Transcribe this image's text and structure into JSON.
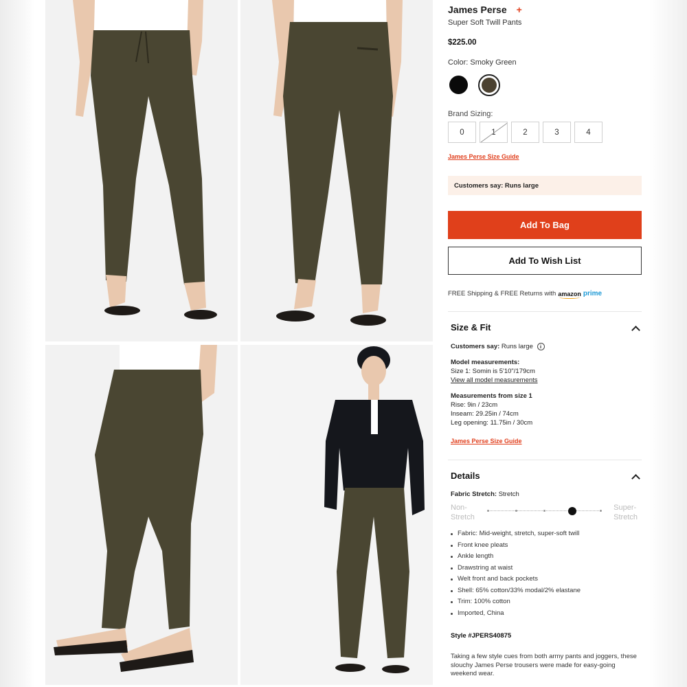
{
  "product": {
    "brand": "James Perse",
    "name": "Super Soft Twill Pants",
    "price": "$225.00",
    "color_label": "Color: Smoky Green",
    "colors": [
      {
        "name": "Black",
        "hex": "#0a0a0a"
      },
      {
        "name": "Smoky Green",
        "hex": "#4b4130",
        "selected": true
      }
    ]
  },
  "sizing": {
    "label": "Brand Sizing:",
    "sizes": [
      "0",
      "1",
      "2",
      "3",
      "4"
    ],
    "unavailable": [
      "1"
    ],
    "guide_link": "James Perse Size Guide"
  },
  "customers_banner": "Customers say: Runs large",
  "buttons": {
    "add_to_bag": "Add To Bag",
    "add_to_wish_list": "Add To Wish List"
  },
  "shipping": {
    "text": "FREE Shipping & FREE Returns with",
    "logo_amazon": "amazon",
    "logo_prime": "prime"
  },
  "size_fit": {
    "title": "Size & Fit",
    "customers_label": "Customers say:",
    "customers_value": "Runs large",
    "model_heading": "Model measurements:",
    "model_size": "Size 1: Somin is 5'10\"/179cm",
    "model_link": "View all model measurements",
    "measurements_heading": "Measurements from size 1",
    "rise": "Rise: 9in / 23cm",
    "inseam": "Inseam: 29.25in / 74cm",
    "leg_opening": "Leg opening: 11.75in / 30cm",
    "guide_link": "James Perse Size Guide"
  },
  "details": {
    "title": "Details",
    "fabric_stretch_label": "Fabric Stretch:",
    "fabric_stretch_value": "Stretch",
    "stretch_scale": {
      "left_label_1": "Non-",
      "left_label_2": "Stretch",
      "right_label_1": "Super-",
      "right_label_2": "Stretch",
      "steps": 5,
      "selected_step": 4
    },
    "bullets": [
      "Fabric: Mid-weight, stretch, super-soft twill",
      "Front knee pleats",
      "Ankle length",
      "Drawstring at waist",
      "Welt front and back pockets",
      "Shell: 65% cotton/33% modal/2% elastane",
      "Trim: 100% cotton",
      "Imported, China"
    ],
    "style_number": "Style #JPERS40875",
    "description": "Taking a few style cues from both army pants and joggers, these slouchy James Perse trousers were made for easy-going weekend wear."
  },
  "photos": {
    "pant_color": "#4a4632",
    "sandal_color": "#1e1a17",
    "skin_color": "#e9c8ae",
    "shirt_color": "#ffffff",
    "sweater_color": "#15171c"
  }
}
